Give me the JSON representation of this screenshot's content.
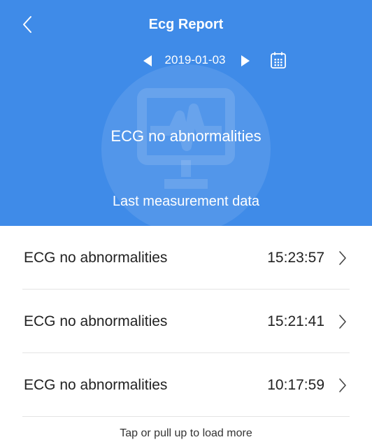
{
  "header": {
    "title": "Ecg Report",
    "date": "2019-01-03",
    "status": "ECG no abnormalities",
    "subtitle": "Last measurement data",
    "background_color": "#3f8be8"
  },
  "records": [
    {
      "label": "ECG no abnormalities",
      "time": "15:23:57"
    },
    {
      "label": "ECG no abnormalities",
      "time": "15:21:41"
    },
    {
      "label": "ECG no abnormalities",
      "time": "10:17:59"
    }
  ],
  "footer": {
    "load_more": "Tap or pull up to load more"
  },
  "icons": {
    "back": "chevron-left-icon",
    "prev": "triangle-left-icon",
    "next": "triangle-right-icon",
    "calendar": "calendar-icon",
    "row": "chevron-right-icon",
    "watermark": "ecg-monitor-icon"
  }
}
